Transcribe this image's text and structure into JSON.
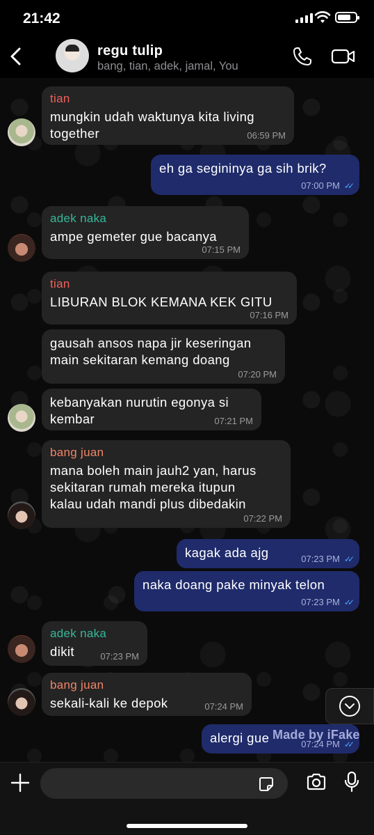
{
  "status": {
    "time": "21:42"
  },
  "header": {
    "title": "regu tulip",
    "subtitle": "bang, tian, adek, jamal, You"
  },
  "messages": [
    {
      "dir": "in",
      "sender": "tian",
      "text": "mungkin udah waktunya kita living\ntogether",
      "time": "06:59 PM"
    },
    {
      "dir": "out",
      "text": "eh ga segininya ga sih brik?",
      "time": "07:00 PM"
    },
    {
      "dir": "in",
      "sender": "adek naka",
      "text": "ampe gemeter gue bacanya",
      "time": "07:15 PM"
    },
    {
      "dir": "in",
      "sender": "tian",
      "text": "LIBURAN BLOK KEMANA KEK GITU",
      "time": "07:16 PM"
    },
    {
      "dir": "in",
      "text": "gausah ansos napa jir keseringan\nmain sekitaran kemang doang",
      "time": "07:20 PM"
    },
    {
      "dir": "in",
      "text": "kebanyakan nurutin egonya si\nkembar",
      "time": "07:21 PM"
    },
    {
      "dir": "in",
      "sender": "bang juan",
      "text": "mana boleh main jauh2 yan, harus\nsekitaran rumah mereka itupun\nkalau udah mandi plus dibedakin",
      "time": "07:22 PM"
    },
    {
      "dir": "out",
      "text": "kagak ada ajg",
      "time": "07:23 PM"
    },
    {
      "dir": "out",
      "text": "naka doang pake minyak telon",
      "time": "07:23 PM"
    },
    {
      "dir": "in",
      "sender": "adek naka",
      "text": "dikit",
      "time": "07:23 PM"
    },
    {
      "dir": "in",
      "sender": "bang juan",
      "text": "sekali-kali ke depok",
      "time": "07:24 PM"
    },
    {
      "dir": "out",
      "text": "alergi gue",
      "time": "07:24 PM"
    }
  ],
  "watermark": "Made by iFake",
  "input": {
    "placeholder": ""
  },
  "colors": {
    "tian": "#f0625d",
    "adek_naka": "#35b89a",
    "bang_juan": "#f28466",
    "outgoing": "#1f2b6b",
    "incoming": "#242424",
    "read_ticks": "#4aa8ff"
  }
}
